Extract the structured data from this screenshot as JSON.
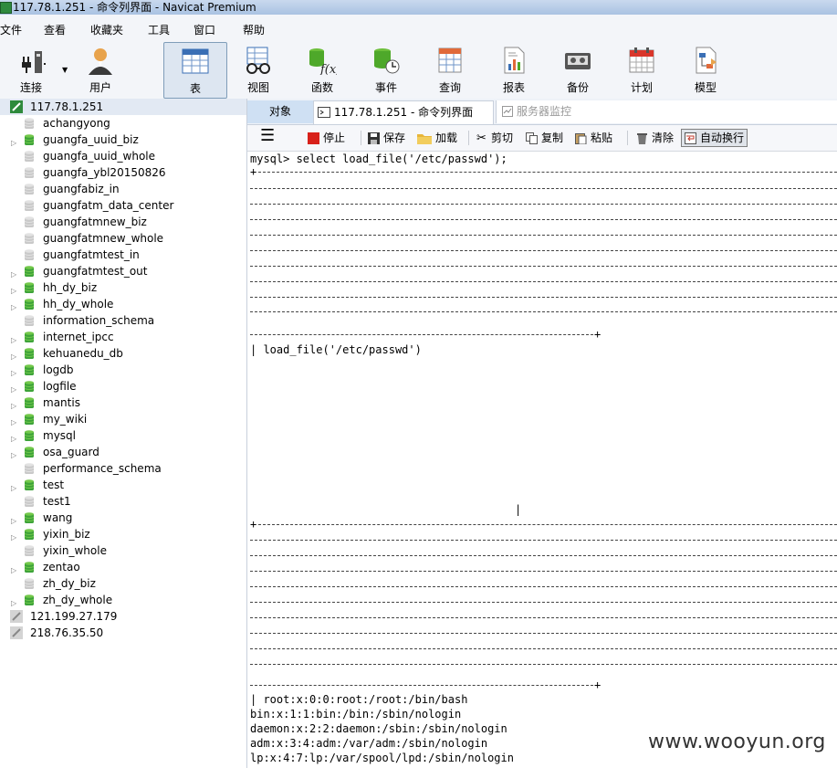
{
  "window": {
    "title": "117.78.1.251 - 命令列界面 - Navicat Premium"
  },
  "menu": [
    "文件",
    "查看",
    "收藏夹",
    "工具",
    "窗口",
    "帮助"
  ],
  "toolbar": [
    {
      "label": "连接",
      "icon": "plug-icon"
    },
    {
      "label": "用户",
      "icon": "user-icon"
    },
    {
      "label": "表",
      "icon": "table-icon"
    },
    {
      "label": "视图",
      "icon": "glasses-icon"
    },
    {
      "label": "函数",
      "icon": "function-icon"
    },
    {
      "label": "事件",
      "icon": "event-clock-icon"
    },
    {
      "label": "查询",
      "icon": "query-icon"
    },
    {
      "label": "报表",
      "icon": "report-icon"
    },
    {
      "label": "备份",
      "icon": "backup-tape-icon"
    },
    {
      "label": "计划",
      "icon": "calendar-icon"
    },
    {
      "label": "模型",
      "icon": "model-icon"
    }
  ],
  "tree": {
    "connection": "117.78.1.251",
    "databases": [
      {
        "name": "achangyong",
        "open": false
      },
      {
        "name": "guangfa_uuid_biz",
        "open": true
      },
      {
        "name": "guangfa_uuid_whole",
        "open": false
      },
      {
        "name": "guangfa_ybl20150826",
        "open": false
      },
      {
        "name": "guangfabiz_in",
        "open": false
      },
      {
        "name": "guangfatm_data_center",
        "open": false
      },
      {
        "name": "guangfatmnew_biz",
        "open": false
      },
      {
        "name": "guangfatmnew_whole",
        "open": false
      },
      {
        "name": "guangfatmtest_in",
        "open": false
      },
      {
        "name": "guangfatmtest_out",
        "open": true
      },
      {
        "name": "hh_dy_biz",
        "open": true
      },
      {
        "name": "hh_dy_whole",
        "open": true
      },
      {
        "name": "information_schema",
        "open": false
      },
      {
        "name": "internet_ipcc",
        "open": true
      },
      {
        "name": "kehuanedu_db",
        "open": true
      },
      {
        "name": "logdb",
        "open": true
      },
      {
        "name": "logfile",
        "open": true
      },
      {
        "name": "mantis",
        "open": true
      },
      {
        "name": "my_wiki",
        "open": true
      },
      {
        "name": "mysql",
        "open": true
      },
      {
        "name": "osa_guard",
        "open": true
      },
      {
        "name": "performance_schema",
        "open": false
      },
      {
        "name": "test",
        "open": true
      },
      {
        "name": "test1",
        "open": false
      },
      {
        "name": "wang",
        "open": true
      },
      {
        "name": "yixin_biz",
        "open": true
      },
      {
        "name": "yixin_whole",
        "open": false
      },
      {
        "name": "zentao",
        "open": true
      },
      {
        "name": "zh_dy_biz",
        "open": false
      },
      {
        "name": "zh_dy_whole",
        "open": true
      }
    ],
    "other_connections": [
      "121.199.27.179",
      "218.76.35.50"
    ]
  },
  "tabs": {
    "objects": "对象",
    "command": "117.78.1.251 - 命令列界面",
    "monitor": "服务器监控"
  },
  "cmdbar": {
    "stop": "停止",
    "save": "保存",
    "load": "加载",
    "cut": "剪切",
    "copy": "复制",
    "paste": "粘贴",
    "clear": "清除",
    "wrap": "自动换行"
  },
  "console": {
    "query": "mysql> select load_file('/etc/passwd');",
    "border_plus": "+",
    "header": "| load_file('/etc/passwd')",
    "cursor": "|",
    "rows": [
      "| root:x:0:0:root:/root:/bin/bash",
      "bin:x:1:1:bin:/bin:/sbin/nologin",
      "daemon:x:2:2:daemon:/sbin:/sbin/nologin",
      "adm:x:3:4:adm:/var/adm:/sbin/nologin",
      "lp:x:4:7:lp:/var/spool/lpd:/sbin/nologin"
    ]
  },
  "watermark": "www.wooyun.org"
}
